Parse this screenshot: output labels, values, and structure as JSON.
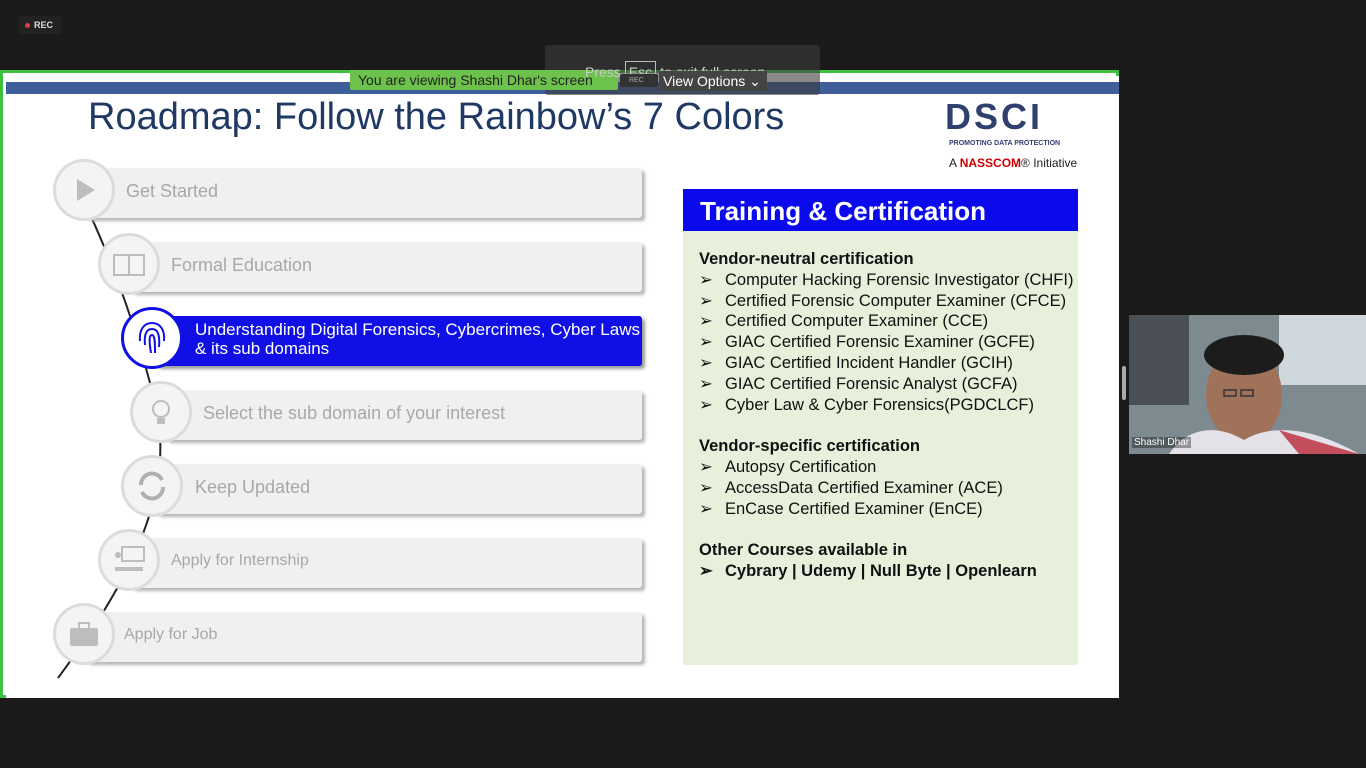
{
  "meeting": {
    "rec_label": "REC",
    "viewing_banner": "You are viewing Shashi Dhar's screen",
    "esc_prefix": "Press",
    "esc_key": "Esc",
    "esc_suffix": "to exit full screen",
    "view_options": "View Options",
    "rec_mini_label": "REC",
    "participant_name": "Shashi Dhar"
  },
  "slide": {
    "title": "Roadmap: Follow the Rainbow’s 7 Colors",
    "logo": {
      "wordmark": "DSCI",
      "tagline": "PROMOTING DATA PROTECTION",
      "sub_prefix": "A",
      "sub_brand": "NASSCOM",
      "sub_suffix": "® Initiative"
    },
    "steps": [
      {
        "label": "Get Started",
        "icon": "play-icon"
      },
      {
        "label": "Formal Education",
        "icon": "book-icon"
      },
      {
        "label": "Understanding Digital Forensics, Cybercrimes, Cyber Laws & its sub domains",
        "icon": "fingerprint-icon"
      },
      {
        "label": "Select the sub domain of your interest",
        "icon": "lightbulb-icon"
      },
      {
        "label": "Keep Updated",
        "icon": "refresh-icon"
      },
      {
        "label": "Apply for Internship",
        "icon": "presentation-icon"
      },
      {
        "label": "Apply for Job",
        "icon": "briefcase-icon"
      }
    ],
    "panel": {
      "title": "Training & Certification",
      "bullet_char": "➢",
      "vendor_neutral_heading": "Vendor-neutral certification",
      "vendor_neutral": [
        "Computer Hacking Forensic Investigator (CHFI)",
        "Certified Forensic Computer Examiner (CFCE)",
        "Certified Computer Examiner (CCE)",
        "GIAC Certified Forensic Examiner (GCFE)",
        "GIAC Certified Incident Handler (GCIH)",
        "GIAC Certified Forensic Analyst (GCFA)",
        "Cyber Law & Cyber Forensics(PGDCLCF)"
      ],
      "vendor_specific_heading": "Vendor-specific certification",
      "vendor_specific": [
        "Autopsy Certification",
        "AccessData Certified Examiner (ACE)",
        "EnCase Certified Examiner (EnCE)"
      ],
      "other_heading": "Other Courses available in",
      "other": "Cybrary | Udemy | Null Byte | Openlearn"
    }
  },
  "colors": {
    "share_border": "#3fc03f",
    "active_step": "#1010e6",
    "panel_head": "#0a0aec",
    "panel_bg": "#e6f0da",
    "title": "#1f3864"
  }
}
